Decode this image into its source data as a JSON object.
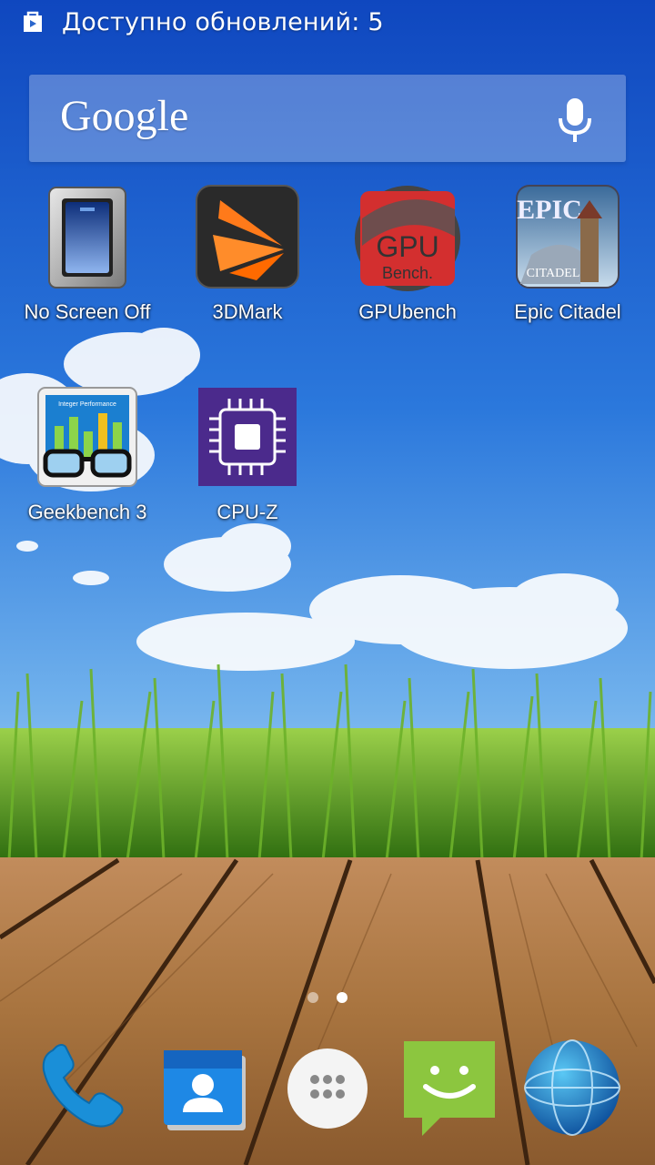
{
  "status_bar": {
    "notification_icon": "play-store-bag-icon",
    "text": "Доступно обновлений: 5"
  },
  "search": {
    "logo": "Google",
    "mic_icon": "microphone-icon"
  },
  "apps": [
    {
      "label": "No Screen Off",
      "icon": "toggle-switch-icon"
    },
    {
      "label": "3DMark",
      "icon": "3dmark-logo-icon"
    },
    {
      "label": "GPUbench",
      "icon": "gpu-bench-icon"
    },
    {
      "label": "Epic Citadel",
      "icon": "epic-citadel-icon"
    },
    {
      "label": "Geekbench 3",
      "icon": "geekbench-glasses-icon"
    },
    {
      "label": "CPU-Z",
      "icon": "cpu-chip-icon"
    }
  ],
  "gpu_icon_text": {
    "line1": "GPU",
    "line2": "Bench."
  },
  "epic_icon_text": {
    "line1": "EPIC",
    "line2": "CITADEL"
  },
  "geekbench_icon_text": "Integer Performance",
  "page_indicator": {
    "pages": 2,
    "current": 2
  },
  "dock": [
    {
      "name": "phone",
      "icon": "phone-icon"
    },
    {
      "name": "contacts",
      "icon": "contacts-icon"
    },
    {
      "name": "app-drawer",
      "icon": "all-apps-icon"
    },
    {
      "name": "messaging",
      "icon": "sms-smiley-icon"
    },
    {
      "name": "browser",
      "icon": "globe-icon"
    }
  ],
  "colors": {
    "sky_top": "#1553c9",
    "sky_bottom": "#8ec3f0",
    "grass": "#5aa21c",
    "wood": "#b07c4e",
    "messaging_green": "#8cc63f",
    "phone_blue": "#1a8fd8",
    "cpuz_purple": "#4b2a8c"
  }
}
